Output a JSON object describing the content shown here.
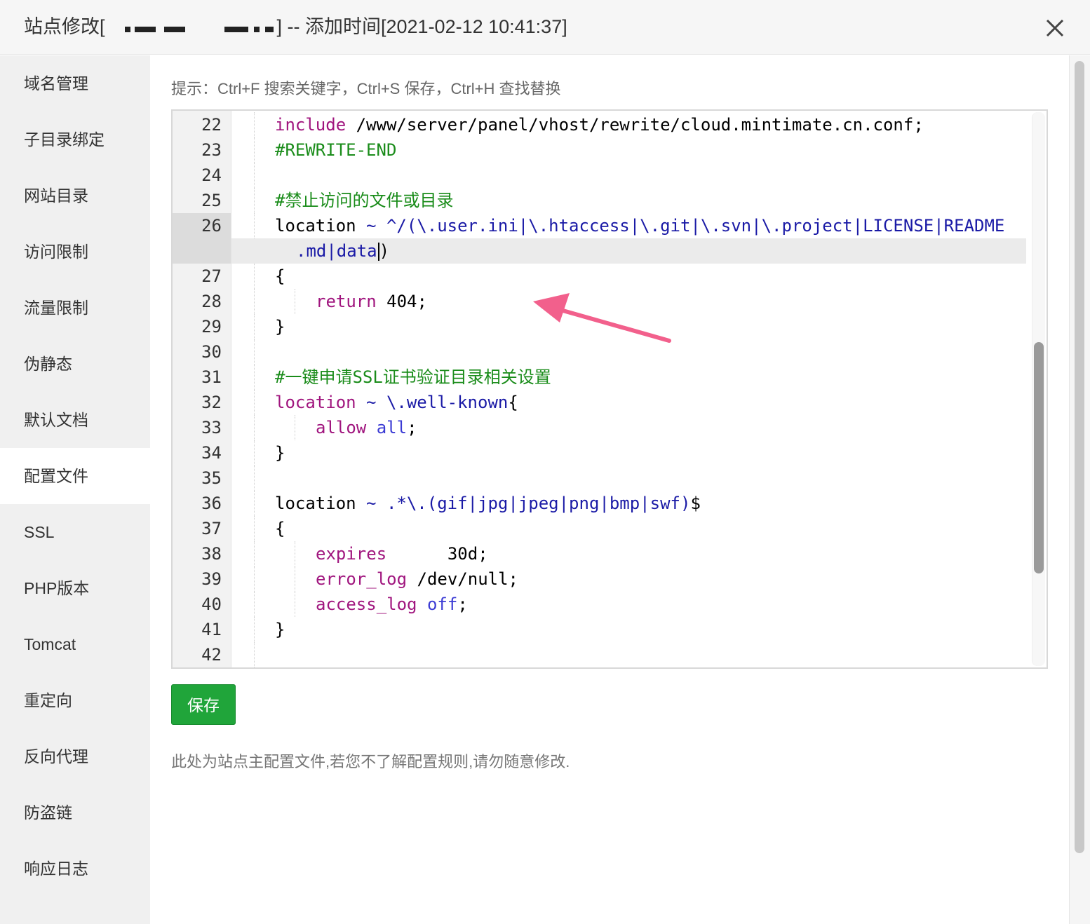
{
  "window": {
    "title_prefix": "站点修改[",
    "title_suffix": "] -- 添加时间[2021-02-12 10:41:37]",
    "close_icon": "close-icon"
  },
  "sidebar": {
    "items": [
      {
        "label": "域名管理"
      },
      {
        "label": "子目录绑定"
      },
      {
        "label": "网站目录"
      },
      {
        "label": "访问限制"
      },
      {
        "label": "流量限制"
      },
      {
        "label": "伪静态"
      },
      {
        "label": "默认文档"
      },
      {
        "label": "配置文件",
        "active": true
      },
      {
        "label": "SSL"
      },
      {
        "label": "PHP版本"
      },
      {
        "label": "Tomcat"
      },
      {
        "label": "重定向"
      },
      {
        "label": "反向代理"
      },
      {
        "label": "防盗链"
      },
      {
        "label": "响应日志"
      }
    ]
  },
  "main": {
    "tip": "提示：Ctrl+F 搜索关键字，Ctrl+S 保存，Ctrl+H 查找替换",
    "save_label": "保存",
    "note": "此处为站点主配置文件,若您不了解配置规则,请勿随意修改."
  },
  "editor": {
    "lines": [
      {
        "n": "22",
        "t1": "include",
        "t2": " /www/server/panel/vhost/rewrite/cloud.mintimate.cn.conf;"
      },
      {
        "n": "23",
        "t1": "#REWRITE-END"
      },
      {
        "n": "24"
      },
      {
        "n": "25",
        "t1": "#禁止访问的文件或目录"
      },
      {
        "n": "26",
        "t1": "location",
        "t2": " ~ ",
        "t3": "^/(\\.user.ini|\\.htaccess|\\.git|\\.svn|\\.project|LICENSE|README",
        "t4": ".md|data",
        "t5": ")"
      },
      {
        "n": "27",
        "t1": "{"
      },
      {
        "n": "28",
        "t1": "return",
        "t2": " 404;"
      },
      {
        "n": "29",
        "t1": "}"
      },
      {
        "n": "30"
      },
      {
        "n": "31",
        "t1": "#一键申请SSL证书验证目录相关设置"
      },
      {
        "n": "32",
        "t1": "location",
        "t2": " ~ ",
        "t3": "\\.well-known",
        "t4": "{"
      },
      {
        "n": "33",
        "t1": "allow",
        "t2": " ",
        "t3": "all",
        "t4": ";"
      },
      {
        "n": "34",
        "t1": "}"
      },
      {
        "n": "35"
      },
      {
        "n": "36",
        "t1": "location",
        "t2": " ~ ",
        "t3": ".*\\.(gif|jpg|jpeg|png|bmp|swf)",
        "t4": "$"
      },
      {
        "n": "37",
        "t1": "{"
      },
      {
        "n": "38",
        "t1": "expires",
        "t2": "      30d;"
      },
      {
        "n": "39",
        "t1": "error_log",
        "t2": " /dev/null;"
      },
      {
        "n": "40",
        "t1": "access_log",
        "t2": " ",
        "t3": "off",
        "t4": ";"
      },
      {
        "n": "41",
        "t1": "}"
      },
      {
        "n": "42"
      }
    ]
  },
  "colors": {
    "save_button": "#20a53a",
    "keyword": "#a0157e",
    "comment": "#1a8c1a",
    "regex": "#1a1aa6",
    "annotation_arrow": "#f2608c"
  }
}
